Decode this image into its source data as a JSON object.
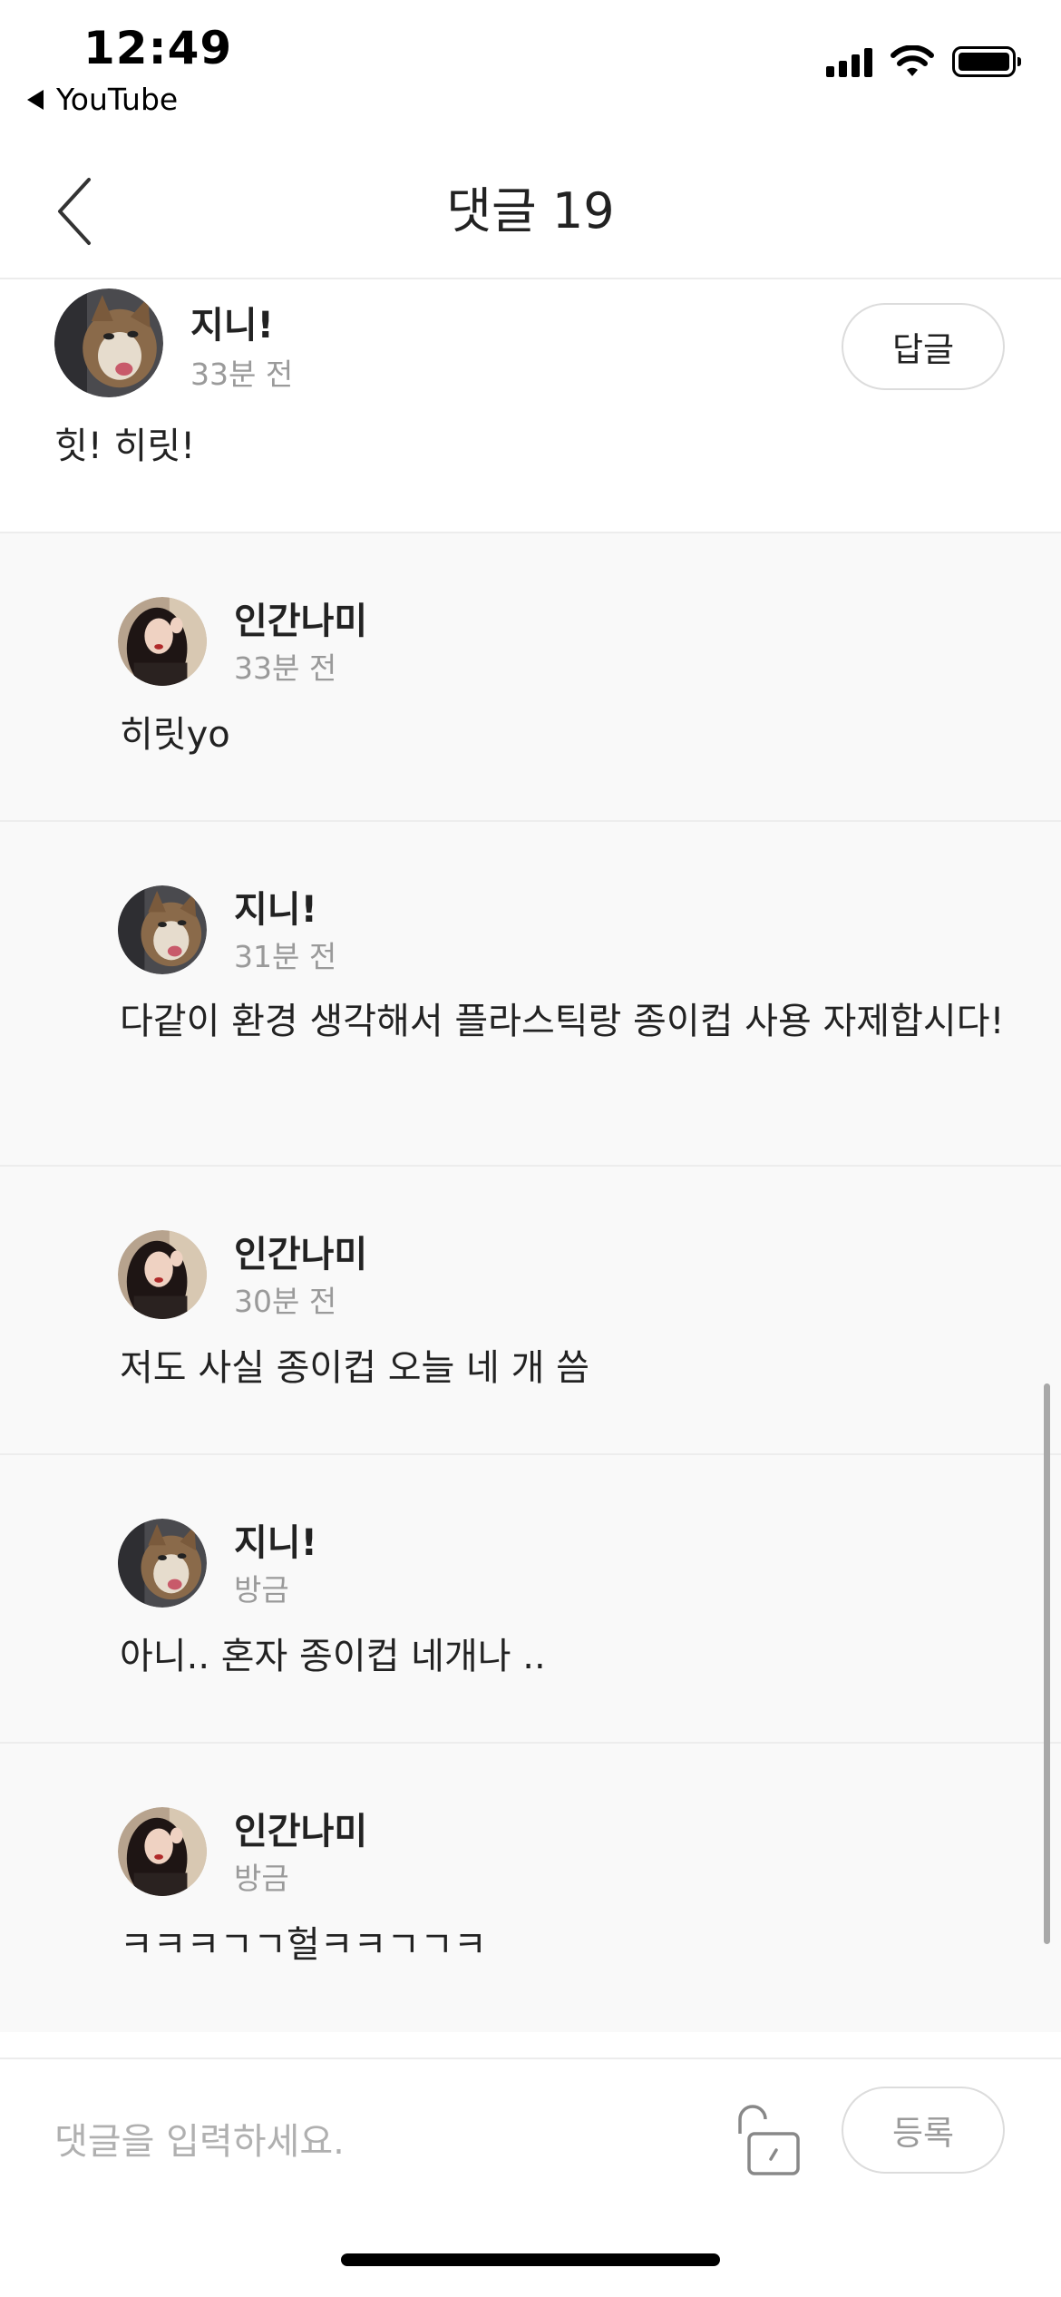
{
  "status_bar": {
    "time": "12:49",
    "back_app_label": "YouTube"
  },
  "header": {
    "title": "댓글 19"
  },
  "comments": [
    {
      "author": "지니!",
      "time": "33분 전",
      "text": "힛! 히릿!",
      "reply_label": "답글",
      "avatar": "cat-avatar"
    },
    {
      "author": "인간나미",
      "time": "33분 전",
      "text": "히릿yo",
      "avatar": "person-avatar"
    },
    {
      "author": "지니!",
      "time": "31분 전",
      "text": "다같이 환경 생각해서 플라스틱랑 종이컵 사용 자제합시다!",
      "avatar": "cat-avatar"
    },
    {
      "author": "인간나미",
      "time": "30분 전",
      "text": "저도 사실 종이컵 오늘 네 개 씀",
      "avatar": "person-avatar"
    },
    {
      "author": "지니!",
      "time": "방금",
      "text": "아니.. 혼자 종이컵 네개나 ..",
      "avatar": "cat-avatar"
    },
    {
      "author": "인간나미",
      "time": "방금",
      "text": "ㅋㅋㅋㄱㄱ헐ㅋㅋㄱㄱㅋ",
      "avatar": "person-avatar"
    }
  ],
  "input_bar": {
    "placeholder": "댓글을 입력하세요.",
    "submit_label": "등록"
  },
  "colors": {
    "reply_background": "#f9f9f9",
    "divider": "#ececec",
    "secondary_text": "#9a9a9a"
  }
}
